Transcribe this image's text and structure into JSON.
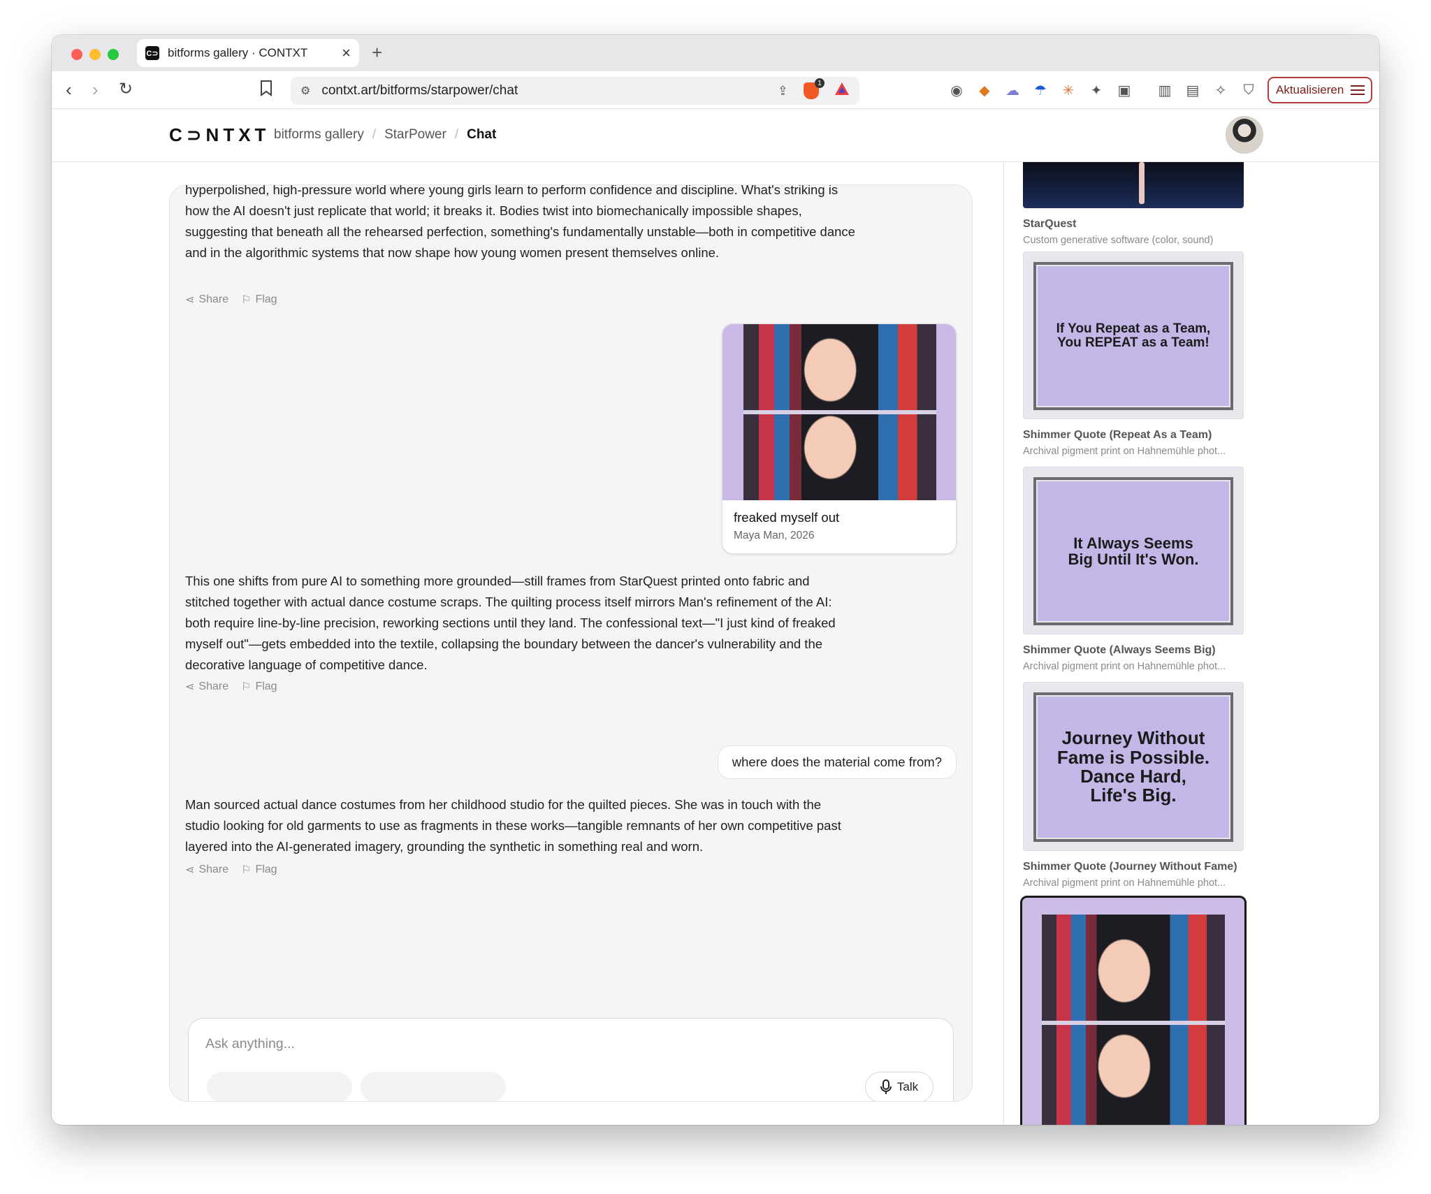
{
  "browser": {
    "tab_title": "bitforms gallery · CONTXT",
    "tab_favicon": "C⊃",
    "url": "contxt.art/bitforms/starpower/chat",
    "update_label": "Aktualisieren",
    "brave_badge": "1"
  },
  "header": {
    "logo": "C⊃NTXT",
    "breadcrumb": [
      "bitforms gallery",
      "StarPower",
      "Chat"
    ]
  },
  "chat": {
    "messages": [
      {
        "role": "assistant",
        "text": "hyperpolished, high-pressure world where young girls learn to perform confidence and discipline. What's striking is how the AI doesn't just replicate that world; it breaks it. Bodies twist into biomechanically impossible shapes, suggesting that beneath all the rehearsed perfection, something's fundamentally unstable—both in competitive dance and in the algorithmic systems that now shape how young women present themselves online."
      },
      {
        "role": "card",
        "title": "freaked myself out",
        "subtitle": "Maya Man, 2026"
      },
      {
        "role": "assistant",
        "text": "This one shifts from pure AI to something more grounded—still frames from StarQuest printed onto fabric and stitched together with actual dance costume scraps. The quilting process itself mirrors Man's refinement of the AI: both require line-by-line precision, reworking sections until they land. The confessional text—\"I just kind of freaked myself out\"—gets embedded into the textile, collapsing the boundary between the dancer's vulnerability and the decorative language of competitive dance."
      },
      {
        "role": "user",
        "text": "where does the material come from?"
      },
      {
        "role": "assistant",
        "text": "Man sourced actual dance costumes from her childhood studio for the quilted pieces. She was in touch with the studio looking for old garments to use as fragments in these works—tangible remnants of her own competitive past layered into the AI-generated imagery, grounding the synthetic in something real and worn."
      }
    ],
    "share_label": "Share",
    "flag_label": "Flag",
    "composer_placeholder": "Ask anything...",
    "talk_label": "Talk"
  },
  "sidebar": {
    "artworks": [
      {
        "title": "StarQuest",
        "subtitle": "Custom generative software (color, sound)"
      },
      {
        "title": "Shimmer Quote (Repeat As a Team)",
        "subtitle": "Archival pigment print on Hahnemühle phot...",
        "quote": "If You Repeat as a Team, You REPEAT as a Team!"
      },
      {
        "title": "Shimmer Quote (Always Seems Big)",
        "subtitle": "Archival pigment print on Hahnemühle phot...",
        "quote": "It Always Seems Big Until It's Won."
      },
      {
        "title": "Shimmer Quote (Journey Without Fame)",
        "subtitle": "Archival pigment print on Hahnemühle phot...",
        "quote": "Journey Without Fame is Possible. Dance Hard, Life's Big."
      }
    ]
  },
  "colors": {
    "update_border": "#b33a3a",
    "frame_lilac": "#c3b7e8",
    "panel_bg": "#f5f5f5"
  }
}
